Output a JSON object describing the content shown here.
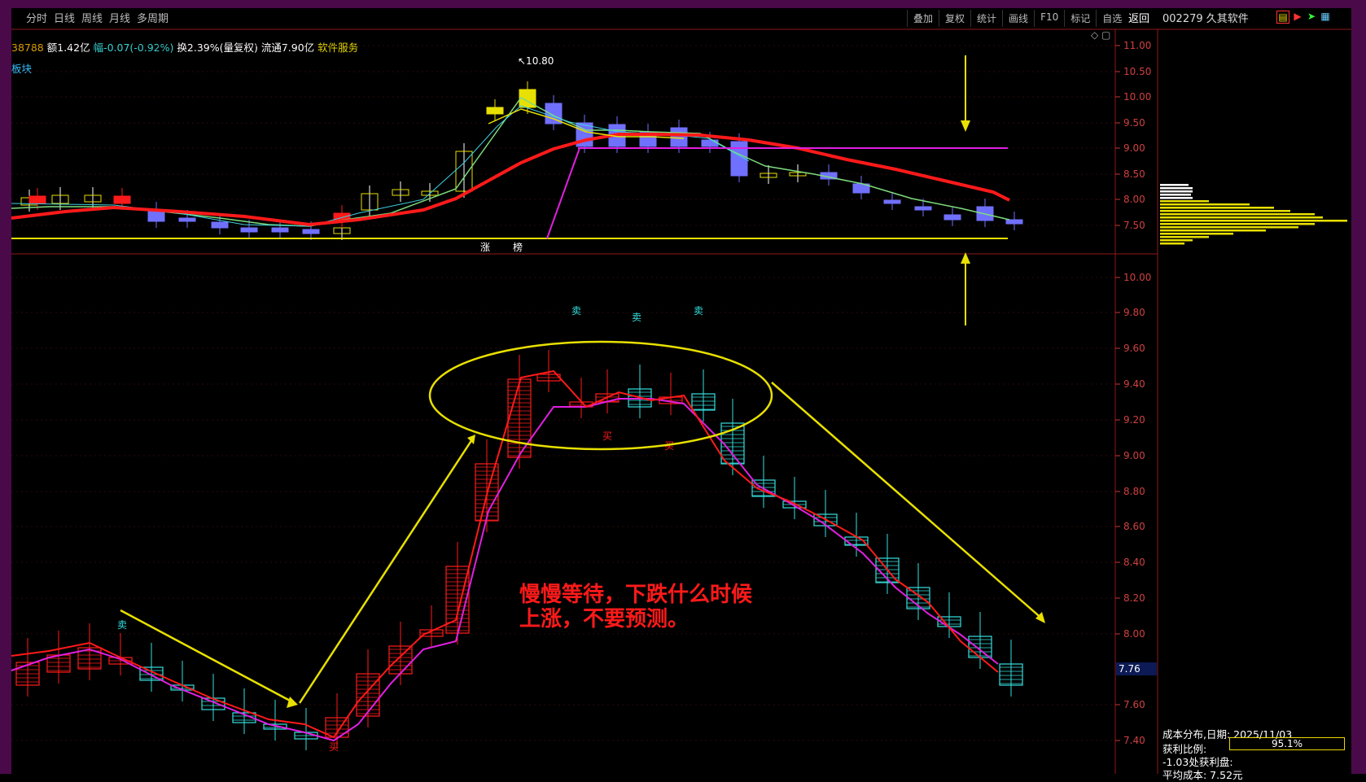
{
  "toolbar": {
    "left_tabs": [
      "分时",
      "日线",
      "周线",
      "月线",
      "多周期"
    ],
    "right_tabs": [
      "叠加",
      "复权",
      "统计",
      "画线",
      "F10",
      "标记",
      "自选"
    ],
    "back_label": "返回"
  },
  "stock": {
    "code_name": "002279 久其软件"
  },
  "info": {
    "vol": "38788",
    "amount_label": "额1.42亿",
    "change_label": "幅-0.07(-0.92%)",
    "turnover_label": "换2.39%(量复权)",
    "float_label": "流通7.90亿",
    "sector_label": "软件服务",
    "board_label": "板块"
  },
  "upper_chart": {
    "y_ticks": [
      "11.00",
      "10.50",
      "10.00",
      "9.50",
      "9.00",
      "8.50",
      "8.00",
      "7.50"
    ],
    "high_label": "10.80",
    "markers": [
      "涨",
      "榜"
    ]
  },
  "lower_chart": {
    "y_ticks": [
      "10.00",
      "9.80",
      "9.60",
      "9.40",
      "9.20",
      "9.00",
      "8.80",
      "8.60",
      "8.40",
      "8.20",
      "8.00",
      "7.60",
      "7.40"
    ],
    "current_price": "7.76",
    "sell_label": "卖",
    "buy_label": "买"
  },
  "annotation": {
    "text_line1": "慢慢等待，下跌什么时候",
    "text_line2": "上涨，不要预测。"
  },
  "cost_panel": {
    "date_label": "成本分布,日期: 2025/11/03",
    "profit_ratio_label": "获利比例:",
    "profit_ratio_value": "95.1%",
    "profit_line": "-1.03处获利盘:",
    "avg_cost": "平均成本: 7.52元"
  },
  "colors": {
    "red": "#ff1a1a",
    "yellow": "#e8e000",
    "cyan": "#35e0e0",
    "magenta": "#e020e0",
    "bluebar": "#7070ff"
  }
}
